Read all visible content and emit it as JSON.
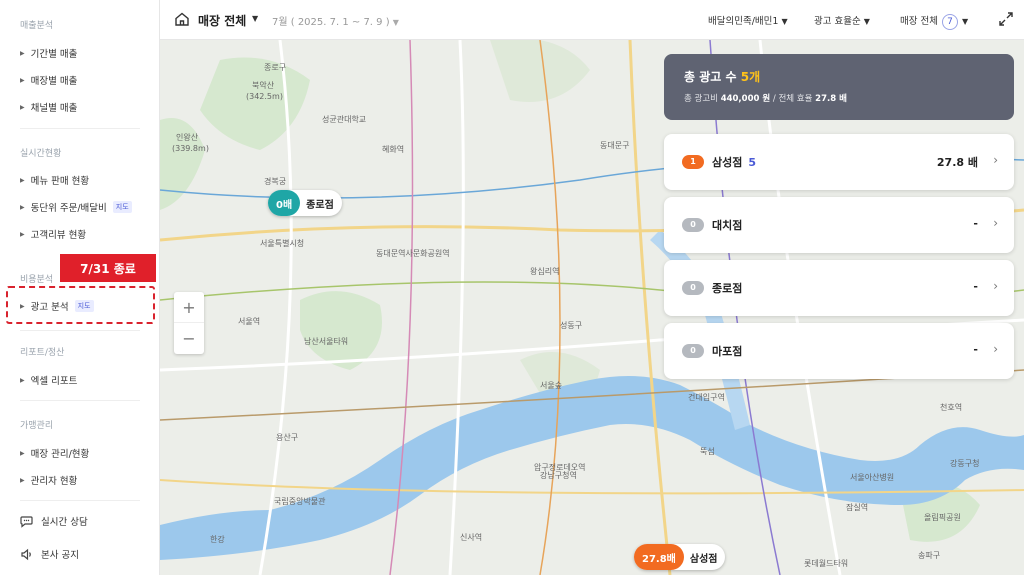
{
  "sidebar": {
    "sections": [
      {
        "title": "매출분석",
        "items": [
          "기간별 매출",
          "매장별 매출",
          "채널별 매출"
        ]
      },
      {
        "title": "실시간현황",
        "items": [
          "메뉴 판매 현황",
          "동단위 주문/배달비",
          "고객리뷰 현황"
        ],
        "tag": "지도"
      },
      {
        "title": "비용분석",
        "items": [
          "광고 분석"
        ],
        "tag": "지도"
      },
      {
        "title": "리포트/정산",
        "items": [
          "엑셀 리포트"
        ]
      },
      {
        "title": "가맹관리",
        "items": [
          "매장 관리/현황",
          "관리자 현황"
        ]
      }
    ],
    "end_badge": "7/31 종료",
    "bottom": {
      "chat": "실시간 상담",
      "notice": "본사 공지"
    }
  },
  "topbar": {
    "store": "매장 전체",
    "period": "7월 ( 2025. 7. 1 ~ 7. 9 )",
    "platform": "배달의민족/배민1",
    "sort": "광고 효율순",
    "store_filter": "매장 전체",
    "store_count": "7"
  },
  "summary": {
    "label": "총 광고 수",
    "count": "5개",
    "detail_label": "총 광고비",
    "cost": "440,000 원",
    "sep": "/ 전체 효율",
    "efficiency": "27.8 배"
  },
  "cards": [
    {
      "rank": "1",
      "store": "삼성점",
      "count": "5",
      "efficiency": "27.8 배",
      "color": "#f26b21"
    },
    {
      "rank": "0",
      "store": "대치점",
      "count": "",
      "efficiency": "-",
      "color": "#b5b9bf"
    },
    {
      "rank": "0",
      "store": "종로점",
      "count": "",
      "efficiency": "-",
      "color": "#b5b9bf"
    },
    {
      "rank": "0",
      "store": "마포점",
      "count": "",
      "efficiency": "-",
      "color": "#b5b9bf"
    }
  ],
  "markers": {
    "jongno": {
      "value": "0배",
      "name": "종로점",
      "color": "#1fa6a6"
    },
    "samsung": {
      "value": "27.8배",
      "name": "삼성점",
      "color": "#f26b21"
    }
  },
  "map": {
    "zoom_in": "+",
    "zoom_out": "−",
    "labels": {
      "bukaksan": "북악산",
      "bukaksan_h": "(342.5m)",
      "inwangsan": "인왕산",
      "inwangsan_h": "(339.8m)",
      "jongno_gu": "종로구",
      "gyeongbokgung": "경복궁",
      "city_hall": "서울특별시청",
      "namsan_tower": "남산서울타워",
      "seoul_station": "서울역",
      "yongsan_gu": "용산구",
      "museum": "국립중앙박물관",
      "hangang": "한강",
      "seongdong_gu": "성동구",
      "dongdaemun_gu": "동대문구",
      "songpa_gu": "송파구",
      "olympic_park": "올림픽공원",
      "lotte_tower": "롯데월드타워",
      "gangnam": "강남구청역",
      "dongdaemun_dp": "동대문역사문화공원역",
      "wangsimni": "왕십리역",
      "ttukseom": "뚝섬",
      "seoul_forest": "서울숲",
      "apgujeong": "압구정로데오역",
      "sinsa": "신사역",
      "jamsil": "잠실역",
      "sejong_univ": "건대입구역",
      "hyehwa": "혜화역",
      "sungkyunkwan": "성균관대학교",
      "cheonho": "천호역",
      "gangdong_gu": "강동구청",
      "hospital": "서울아산병원"
    }
  }
}
